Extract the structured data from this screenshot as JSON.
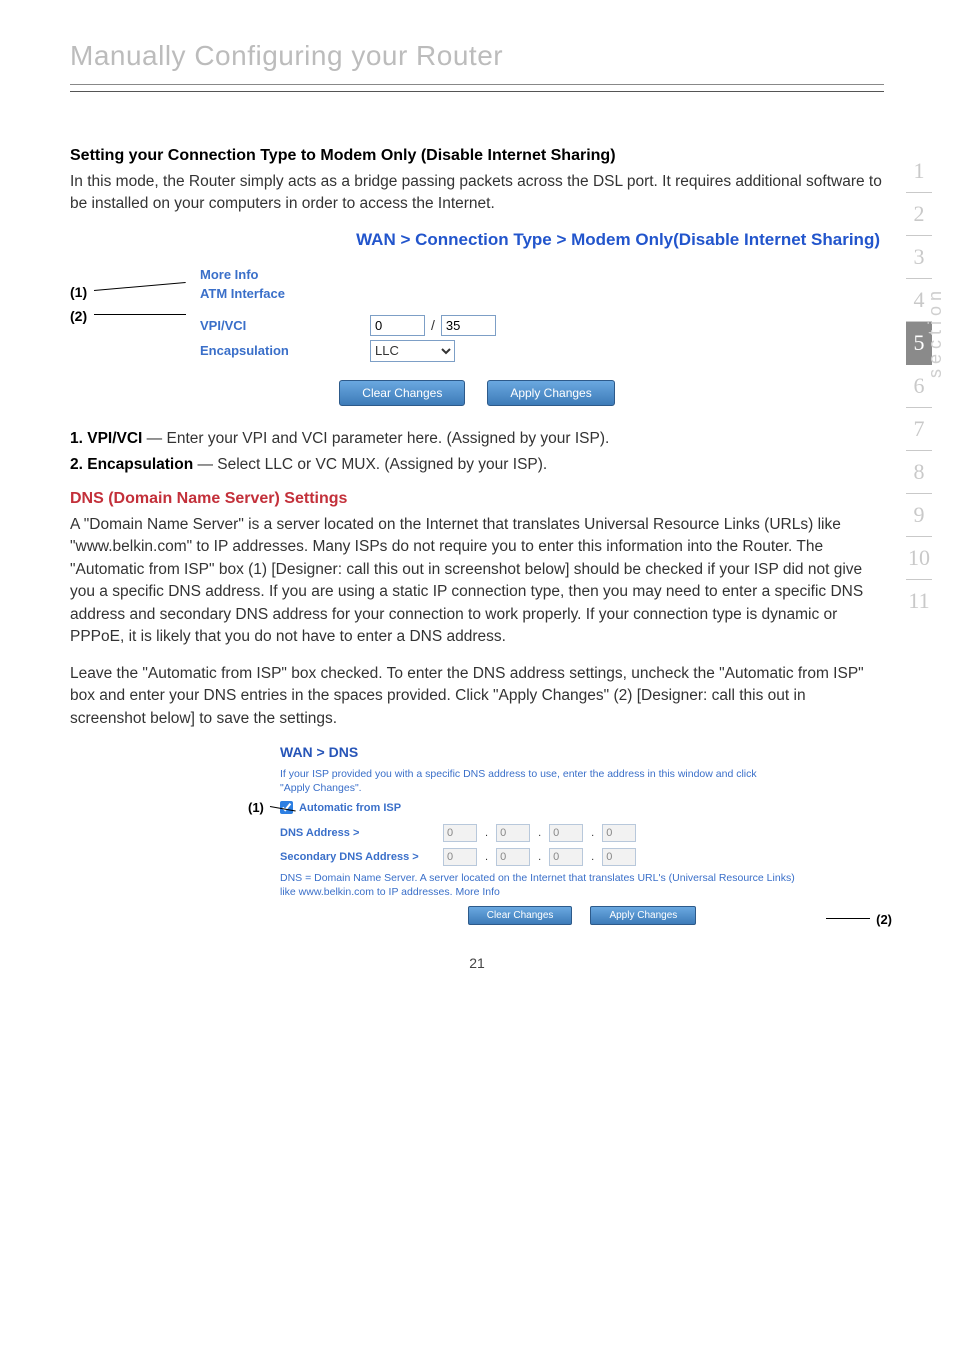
{
  "page": {
    "title": "Manually Configuring your Router",
    "number": "21"
  },
  "rail": {
    "items": [
      "1",
      "2",
      "3",
      "4",
      "5",
      "6",
      "7",
      "8",
      "9",
      "10",
      "11"
    ],
    "active_index": 4,
    "section_label": "section"
  },
  "sec1": {
    "heading": "Setting your Connection Type to Modem Only (Disable Internet Sharing)",
    "body": "In this mode, the Router simply acts as a bridge passing packets across the DSL port. It requires additional software to be installed on your computers in order to access the Internet.",
    "wan_heading": "WAN > Connection Type > Modem Only(Disable Internet Sharing)",
    "more_info": "More Info",
    "atm_interface": "ATM Interface",
    "callout1": "(1)",
    "callout2": "(2)",
    "vpi_vci_label": "VPI/VCI",
    "vpi_value": "0",
    "vci_value": "35",
    "encap_label": "Encapsulation",
    "encap_value": "LLC",
    "clear_btn": "Clear Changes",
    "apply_btn": "Apply Changes",
    "line1_b": "1. VPI/VCI",
    "line1_rest": " — Enter your VPI and VCI parameter here. (Assigned by your ISP).",
    "line2_b": "2. Encapsulation",
    "line2_rest": " — Select LLC or VC MUX. (Assigned by your ISP)."
  },
  "dns": {
    "heading": "DNS (Domain Name Server) Settings",
    "body1": "A \"Domain Name Server\" is a server located on the Internet that translates Universal Resource Links (URLs) like \"www.belkin.com\" to IP addresses. Many ISPs do not require you to enter this information into the Router. The \"Automatic from ISP\" box (1) [Designer: call this out in screenshot below] should be checked if your ISP did not give you a specific DNS address. If you are using a static IP connection type, then you may need to enter a specific DNS address and secondary DNS address for your connection to work properly. If your connection type is dynamic or PPPoE, it is likely that you do not have to enter a DNS address.",
    "body2": "Leave the \"Automatic from ISP\" box checked. To enter the DNS address settings, uncheck the \"Automatic from ISP\" box and enter your DNS entries in the spaces provided. Click \"Apply Changes\" (2) [Designer: call this out in screenshot below] to save the settings.",
    "wan_dns": "WAN > DNS",
    "note": "If your ISP provided you with a specific DNS address to use, enter the address in this window and click \"Apply Changes\".",
    "auto_label": "Automatic from ISP",
    "dns_addr_label": "DNS Address >",
    "sec_dns_label": "Secondary DNS Address >",
    "ip_placeholder": "0",
    "footer_note": "DNS = Domain Name Server. A server located on the Internet that translates URL's (Universal Resource Links) like www.belkin.com to IP addresses.",
    "more_info": "More Info",
    "clear_btn": "Clear Changes",
    "apply_btn": "Apply Changes",
    "callout1": "(1)",
    "callout2": "(2)"
  }
}
